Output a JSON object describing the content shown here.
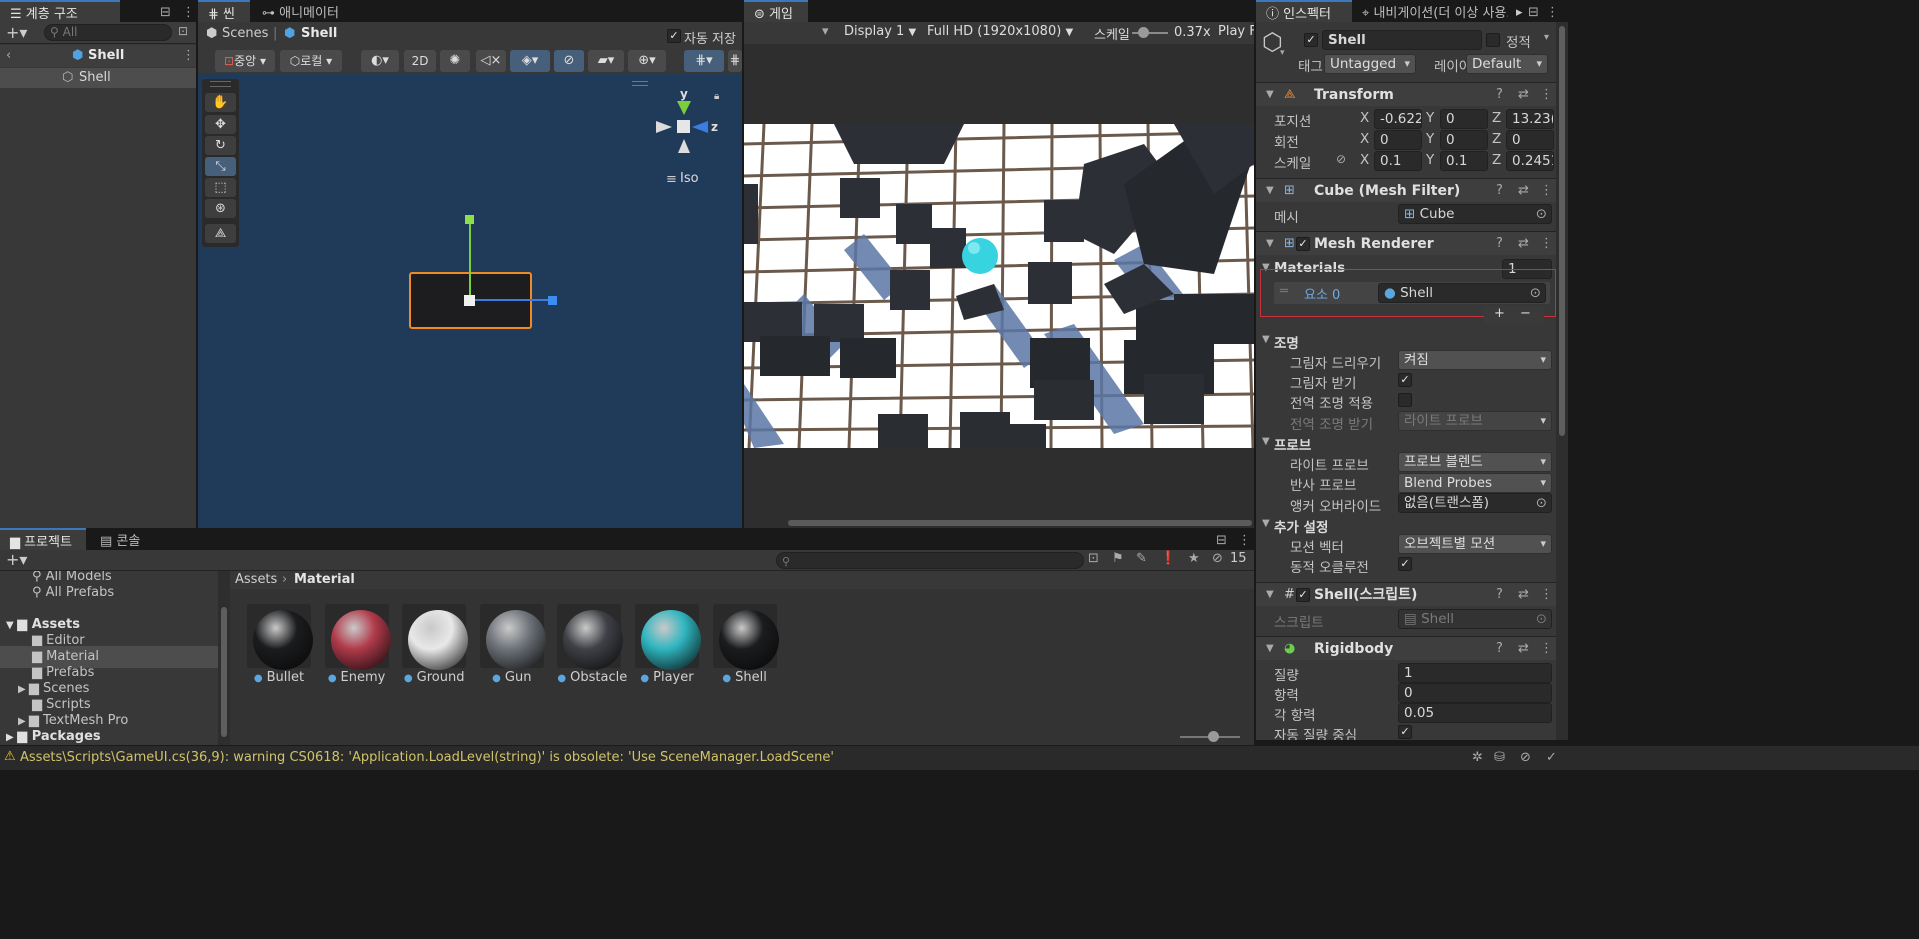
{
  "hierarchy": {
    "tab": "계층 구조",
    "search_placeholder": "All",
    "root": "Shell",
    "child": "Shell",
    "lock": "🔒"
  },
  "scene": {
    "tab": "씬",
    "tab2": "애니메이터",
    "breadcrumb_root": "Scenes",
    "breadcrumb_item": "Shell",
    "autosave": "자동 저장",
    "pivot": "중앙",
    "space": "로컬",
    "mode2d": "2D",
    "iso": "Iso",
    "axis_y": "y",
    "axis_z": "z"
  },
  "game": {
    "tab": "게임",
    "display": "Display 1",
    "resolution": "Full HD (1920x1080)",
    "scale_label": "스케일",
    "scale_value": "0.37x",
    "play": "Play F"
  },
  "inspector": {
    "tab": "인스펙터",
    "tab2": "내비게이션(더 이상 사용...",
    "object_name": "Shell",
    "static_label": "정적",
    "tag_label": "태그",
    "tag_value": "Untagged",
    "layer_label": "레이어",
    "layer_value": "Default",
    "transform": {
      "title": "Transform",
      "position_label": "포지션",
      "rotation_label": "회전",
      "scale_label": "스케일",
      "px": "-0.622",
      "py": "0",
      "pz": "13.23(",
      "rx": "0",
      "ry": "0",
      "rz": "0",
      "sx": "0.1",
      "sy": "0.1",
      "sz": "0.2451"
    },
    "mesh_filter": {
      "title": "Cube (Mesh Filter)",
      "mesh_label": "메시",
      "mesh_value": "Cube"
    },
    "mesh_renderer": {
      "title": "Mesh Renderer",
      "materials_label": "Materials",
      "materials_count": "1",
      "element_label": "요소 0",
      "element_value": "Shell",
      "lighting_title": "조명",
      "cast_label": "그림자 드리우기",
      "cast_value": "켜짐",
      "receive_label": "그림자 받기",
      "gi_label": "전역 조명 적용",
      "gi_recv_label": "전역 조명 받기",
      "gi_recv_value": "라이트 프로브",
      "probes_title": "프로브",
      "light_probe_label": "라이트 프로브",
      "light_probe_value": "프로브 블렌드",
      "reflection_label": "반사 프로브",
      "reflection_value": "Blend Probes",
      "anchor_label": "앵커 오버라이드",
      "anchor_value": "없음(트랜스폼)",
      "extra_title": "추가 설정",
      "motion_label": "모션 벡터",
      "motion_value": "오브젝트별 모션",
      "occlusion_label": "동적 오클루전"
    },
    "script": {
      "title": "Shell(스크립트)",
      "script_label": "스크립트",
      "script_value": "Shell"
    },
    "rigidbody": {
      "title": "Rigidbody",
      "mass_label": "질량",
      "mass": "1",
      "drag_label": "항력",
      "drag": "0",
      "angular_label": "각 항력",
      "angular": "0.05",
      "auto_label": "자동 질량 중심"
    }
  },
  "project": {
    "tab": "프로젝트",
    "tab2": "콘솔",
    "count": "15",
    "breadcrumb_root": "Assets",
    "breadcrumb_item": "Material",
    "tree": [
      "All Models",
      "All Prefabs",
      "Assets",
      "Editor",
      "Material",
      "Prefabs",
      "Scenes",
      "Scripts",
      "TextMesh Pro",
      "Packages"
    ],
    "materials": [
      {
        "name": "Bullet",
        "color": "#1b1c1e"
      },
      {
        "name": "Enemy",
        "color": "#b03a4a"
      },
      {
        "name": "Ground",
        "color": "#e8e8e8"
      },
      {
        "name": "Gun",
        "color": "#6e737a"
      },
      {
        "name": "Obstacle",
        "color": "#3f4147"
      },
      {
        "name": "Player",
        "color": "#2fb5bf"
      },
      {
        "name": "Shell",
        "color": "#1b1c1e"
      }
    ]
  },
  "status": {
    "warning": "Assets\\Scripts\\GameUI.cs(36,9): warning CS0618: 'Application.LoadLevel(string)' is obsolete: 'Use SceneManager.LoadScene'"
  }
}
